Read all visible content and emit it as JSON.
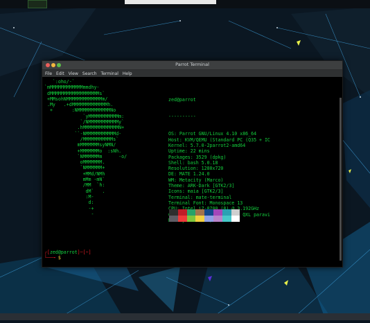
{
  "window": {
    "title": "Parrot Terminal"
  },
  "menu": [
    "File",
    "Edit",
    "View",
    "Search",
    "Terminal",
    "Help"
  ],
  "logo": [
    "   `:oho/-`",
    "`mMMMMMMMMMMMMmmdhy-",
    " dMMMMMMMMMMMMMMMMMMs`",
    " +MMsohNMMMMMMMMMMMMMm/",
    " .My   .+dMMMMMMMMMMMMMh.",
    "  +       :NMMMMMMMMMMMMNo",
    "              `yMMMMMMMMMMMm:",
    "             `/NMMMMMMMMMMMy`",
    "            .hMMMMMMMMMMMMMN+",
    "           ``-NMMMMMMMMMMMd-",
    "             /MMMMMMMMMMMs`",
    "            mMMMMMMMsyNMN/",
    "            +MMMMMMMo  :sNh.",
    "            `NMMMMMMm      -o/",
    "             oMMMMMMM.",
    "             `NMMMMMM+",
    "              +MMd/NMh",
    "              mMm -mN`",
    "              /MM  `h:",
    "               dM`   .",
    "               :M-",
    "                d:",
    "                -+",
    "                 -"
  ],
  "sysinfo": {
    "user_host": "zed@parrot",
    "separator": "----------",
    "rows": [
      {
        "key": "OS:",
        "value": "Parrot GNU/Linux 4.10 x86_64"
      },
      {
        "key": "Host:",
        "value": "KVM/QEMU (Standard PC (Q35 + IC"
      },
      {
        "key": "Kernel:",
        "value": "5.7.0-2parrot2-amd64"
      },
      {
        "key": "Uptime:",
        "value": "22 mins"
      },
      {
        "key": "Packages:",
        "value": "3529 (dpkg)"
      },
      {
        "key": "Shell:",
        "value": "bash 5.0.18"
      },
      {
        "key": "Resolution:",
        "value": "1280x720"
      },
      {
        "key": "DE:",
        "value": "MATE 1.24.0"
      },
      {
        "key": "WM:",
        "value": "Metacity (Marco)"
      },
      {
        "key": "Theme:",
        "value": "ARK-Dark [GTK2/3]"
      },
      {
        "key": "Icons:",
        "value": "maia [GTK2/3]"
      },
      {
        "key": "Terminal:",
        "value": "mate-terminal"
      },
      {
        "key": "Terminal Font:",
        "value": "Monospace 13"
      },
      {
        "key": "CPU:",
        "value": "Intel i7-8700 (8) @ 3.192GHz"
      },
      {
        "key": "GPU:",
        "value": "00:01.0 Red Hat, Inc. QXL paravi"
      },
      {
        "key": "Memory:",
        "value": "642MiB / 9966MiB"
      }
    ]
  },
  "palette": {
    "row1": [
      "#2e2e2e",
      "#c01c28",
      "#26a269",
      "#a2734c",
      "#12488b",
      "#a347ba",
      "#2aa1b3",
      "#cfcfcf"
    ],
    "row2": [
      "#5e5c64",
      "#f03939",
      "#7ec63d",
      "#f4d03f",
      "#8fa0e6",
      "#b983c9",
      "#46c9c9",
      "#ffffff"
    ]
  },
  "prompt": {
    "open": "┌[",
    "user": "zed@parrot",
    "mid": "]─[",
    "dir": "~",
    "close": "]",
    "line2_prefix": "└──╼ ",
    "dollar": "$"
  }
}
